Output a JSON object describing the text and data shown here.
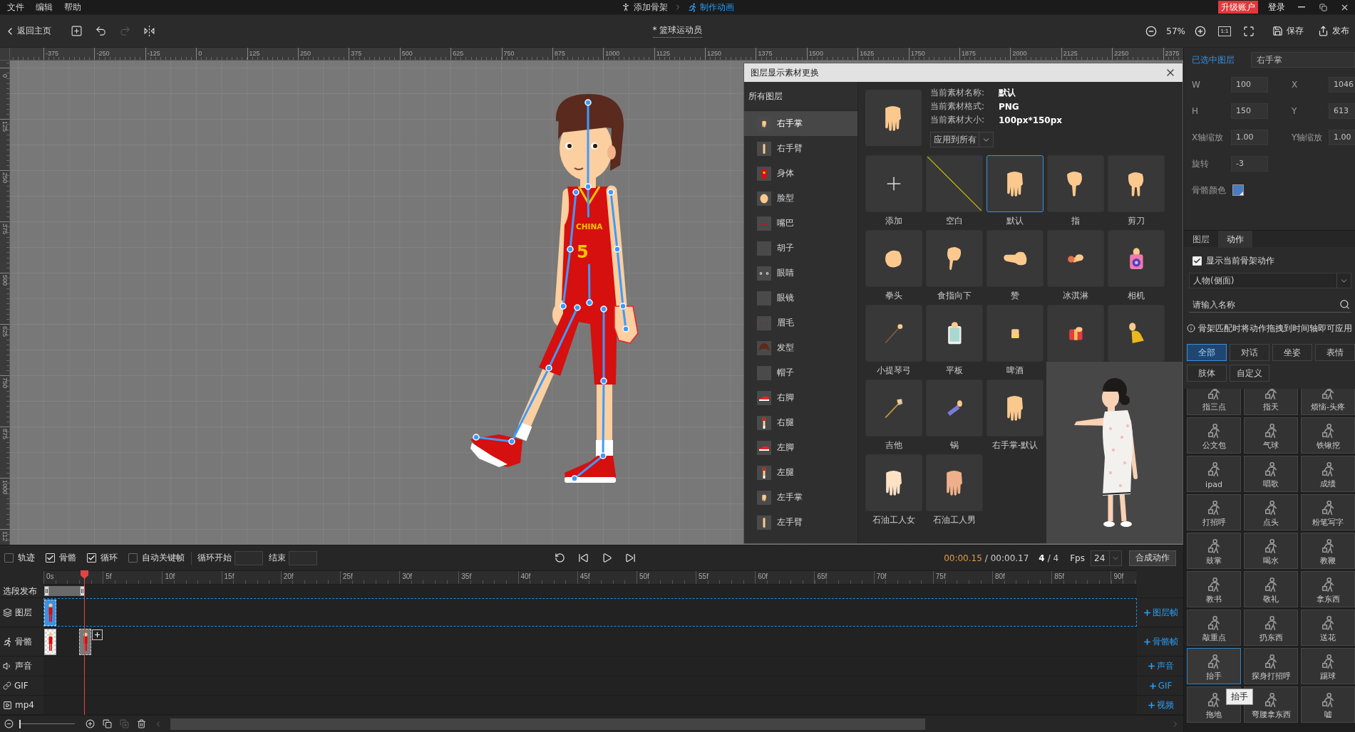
{
  "menu_bar": {
    "menus": [
      "文件",
      "编辑",
      "帮助"
    ],
    "steps": [
      {
        "label": "添加骨架",
        "selected": false
      },
      {
        "label": "制作动画",
        "selected": true
      }
    ],
    "upgrade": "升级账户",
    "login": "登录"
  },
  "toolbar": {
    "back": "返回主页",
    "tools": [
      {
        "kind": "add_frame",
        "disabled": false
      },
      {
        "kind": "undo",
        "disabled": false
      },
      {
        "kind": "redo",
        "disabled": true
      },
      {
        "kind": "mirror",
        "disabled": false
      }
    ],
    "title": "* 篮球运动员",
    "zoom": "57%",
    "actual_size": "1:1",
    "save": "保存",
    "publish": "发布"
  },
  "rulers": {
    "x_marks": [
      "-375",
      "-250",
      "-125",
      "0",
      "125",
      "250",
      "375",
      "500",
      "625",
      "750",
      "875",
      "1000",
      "1125",
      "1250",
      "1375",
      "1500",
      "1625",
      "1750",
      "1875",
      "2000",
      "2125",
      "2250",
      "2375"
    ],
    "y_marks": [
      "0",
      "125",
      "250",
      "375",
      "500",
      "625",
      "750",
      "875",
      "1000",
      "112"
    ]
  },
  "canvas": {
    "jersey_text": "CHINA",
    "jersey_number": "5"
  },
  "layer_dialog": {
    "title": "图层显示素材更换",
    "layers_heading": "所有图层",
    "layers": [
      {
        "label": "右手掌",
        "selected": true
      },
      {
        "label": "右手臂",
        "selected": false
      },
      {
        "label": "身体",
        "selected": false
      },
      {
        "label": "脸型",
        "selected": false
      },
      {
        "label": "嘴巴",
        "selected": false
      },
      {
        "label": "胡子",
        "selected": false
      },
      {
        "label": "眼睛",
        "selected": false
      },
      {
        "label": "眼镜",
        "selected": false
      },
      {
        "label": "眉毛",
        "selected": false
      },
      {
        "label": "发型",
        "selected": false
      },
      {
        "label": "帽子",
        "selected": false
      },
      {
        "label": "右脚",
        "selected": false
      },
      {
        "label": "右腿",
        "selected": false
      },
      {
        "label": "左脚",
        "selected": false
      },
      {
        "label": "左腿",
        "selected": false
      },
      {
        "label": "左手掌",
        "selected": false
      },
      {
        "label": "左手臂",
        "selected": false
      }
    ],
    "info": [
      {
        "label": "当前素材名称:",
        "value": "默认"
      },
      {
        "label": "当前素材格式:",
        "value": "PNG"
      },
      {
        "label": "当前素材大小:",
        "value": "100px*150px"
      }
    ],
    "apply": "应用到所有",
    "material_rows": [
      [
        {
          "kind": "add",
          "label": "添加",
          "selected": false
        },
        {
          "kind": "blank",
          "label": "空白",
          "selected": false
        },
        {
          "kind": "picture",
          "label": "默认",
          "selected": true
        },
        {
          "kind": "picture",
          "label": "指",
          "selected": false
        },
        {
          "kind": "picture",
          "label": "剪刀",
          "selected": false
        }
      ],
      [
        {
          "kind": "picture",
          "label": "拳头",
          "selected": false
        },
        {
          "kind": "picture",
          "label": "食指向下",
          "selected": false
        },
        {
          "kind": "picture",
          "label": "赞",
          "selected": false
        },
        {
          "kind": "picture",
          "label": "冰淇淋",
          "selected": false
        },
        {
          "kind": "picture",
          "label": "相机",
          "selected": false
        }
      ],
      [
        {
          "kind": "picture",
          "label": "小提琴弓",
          "selected": false
        },
        {
          "kind": "picture",
          "label": "平板",
          "selected": false
        },
        {
          "kind": "picture",
          "label": "啤酒",
          "selected": false
        },
        {
          "kind": "picture",
          "selected": false
        },
        {
          "kind": "picture",
          "selected": false
        }
      ],
      [
        {
          "kind": "picture",
          "label": "吉他",
          "selected": false
        },
        {
          "kind": "picture",
          "label": "锅",
          "selected": false
        },
        {
          "kind": "picture",
          "label": "右手掌-默认",
          "selected": false
        }
      ],
      [
        {
          "kind": "picture",
          "label": "石油工人女",
          "selected": false
        },
        {
          "kind": "picture",
          "label": "石油工人男",
          "selected": false
        }
      ]
    ]
  },
  "properties": {
    "heading": "已选中图层",
    "layer_name": "右手掌",
    "rows": [
      [
        {
          "label": "W",
          "kind": "number",
          "value": "100"
        },
        {
          "label": "X",
          "kind": "number",
          "value": "1046"
        }
      ],
      [
        {
          "label": "H",
          "kind": "number",
          "value": "150"
        },
        {
          "label": "Y",
          "kind": "number",
          "value": "613"
        }
      ],
      [
        {
          "label": "X轴缩放",
          "kind": "number",
          "value": "1.00"
        },
        {
          "label": "Y轴缩放",
          "kind": "number",
          "value": "1.00"
        }
      ],
      [
        {
          "label": "旋转",
          "kind": "number",
          "value": "-3"
        }
      ],
      [
        {
          "label": "骨骼颜色",
          "kind": "color",
          "color": "#4a7bc4"
        }
      ]
    ]
  },
  "action_panel": {
    "tabs": [
      {
        "label": "图层",
        "selected": false
      },
      {
        "label": "动作",
        "selected": true
      }
    ],
    "show_current": {
      "label": "显示当前骨架动作",
      "checked": true
    },
    "character_type": "人物(侧面)",
    "search_placeholder": "请输入名称",
    "hint": "骨架匹配时将动作拖拽到时间轴即可应用",
    "filters": [
      {
        "label": "全部",
        "selected": true
      },
      {
        "label": "对话",
        "selected": false
      },
      {
        "label": "坐姿",
        "selected": false
      },
      {
        "label": "表情",
        "selected": false
      },
      {
        "label": "肢体",
        "selected": false
      },
      {
        "label": "自定义",
        "selected": false
      }
    ],
    "actions": [
      {
        "label": "指三点",
        "selected": false
      },
      {
        "label": "指天",
        "selected": false
      },
      {
        "label": "烦恼-头疼",
        "selected": false
      },
      {
        "label": "公文包",
        "selected": false
      },
      {
        "label": "气球",
        "selected": false
      },
      {
        "label": "铁锹挖",
        "selected": false
      },
      {
        "label": "ipad",
        "selected": false
      },
      {
        "label": "唱歌",
        "selected": false
      },
      {
        "label": "成绩",
        "selected": false
      },
      {
        "label": "打招呼",
        "selected": false
      },
      {
        "label": "点头",
        "selected": false
      },
      {
        "label": "粉笔写字",
        "selected": false
      },
      {
        "label": "鼓掌",
        "selected": false
      },
      {
        "label": "喝水",
        "selected": false
      },
      {
        "label": "教鞭",
        "selected": false
      },
      {
        "label": "教书",
        "selected": false
      },
      {
        "label": "敬礼",
        "selected": false
      },
      {
        "label": "拿东西",
        "selected": false
      },
      {
        "label": "敲重点",
        "selected": false
      },
      {
        "label": "扔东西",
        "selected": false
      },
      {
        "label": "送花",
        "selected": false
      },
      {
        "label": "抬手",
        "selected": true
      },
      {
        "label": "探身打招呼",
        "selected": false
      },
      {
        "label": "踢球",
        "selected": false
      },
      {
        "label": "拖地",
        "selected": false
      },
      {
        "label": "弯腰拿东西",
        "selected": false
      },
      {
        "label": "嘘",
        "selected": false
      }
    ],
    "tooltip": "抬手"
  },
  "timeline": {
    "options": [
      {
        "label": "轨迹",
        "checked": false
      },
      {
        "label": "骨骼",
        "checked": true
      },
      {
        "label": "循环",
        "checked": true
      },
      {
        "label": "自动关键帧",
        "checked": false
      }
    ],
    "loop_start": "循环开始",
    "loop_end": "结束",
    "current_time": "00:00.15",
    "total_time": "/ 00:00.17",
    "frame": "4",
    "frame_total": "/ 4",
    "fps_label": "Fps",
    "fps": "24",
    "compose": "合成动作",
    "ruler_marks": [
      "0s",
      "5f",
      "10f",
      "15f",
      "20f",
      "25f",
      "30f",
      "35f",
      "40f",
      "45f",
      "50f",
      "55f",
      "60f",
      "65f",
      "70f",
      "75f",
      "80f",
      "85f",
      "90f"
    ],
    "playhead": {
      "level": 0.037
    },
    "tracks": [
      {
        "kind": "range",
        "label": "选段发布",
        "selected": false,
        "level": 0.037
      },
      {
        "kind": "layer",
        "label": "图层",
        "selected": true,
        "add": "图层帧",
        "keyframes": [
          {
            "level": 0,
            "selected": true
          }
        ]
      },
      {
        "kind": "bone",
        "label": "骨骼",
        "selected": false,
        "add": "骨骼帧",
        "keyframes": [
          {
            "level": 0,
            "selected": false
          },
          {
            "level": 0.032,
            "selected": true
          }
        ]
      },
      {
        "kind": "sound",
        "label": "声音",
        "selected": false,
        "add": "声音"
      },
      {
        "kind": "gif",
        "label": "GIF",
        "selected": false,
        "add": "GIF"
      },
      {
        "kind": "video",
        "label": "mp4",
        "selected": false,
        "add": "视频"
      }
    ],
    "zoom_slider": {
      "level": 0
    },
    "bottom_tools": [
      {
        "kind": "copy",
        "disabled": false
      },
      {
        "kind": "paste",
        "disabled": true
      },
      {
        "kind": "delete",
        "disabled": false
      }
    ]
  }
}
